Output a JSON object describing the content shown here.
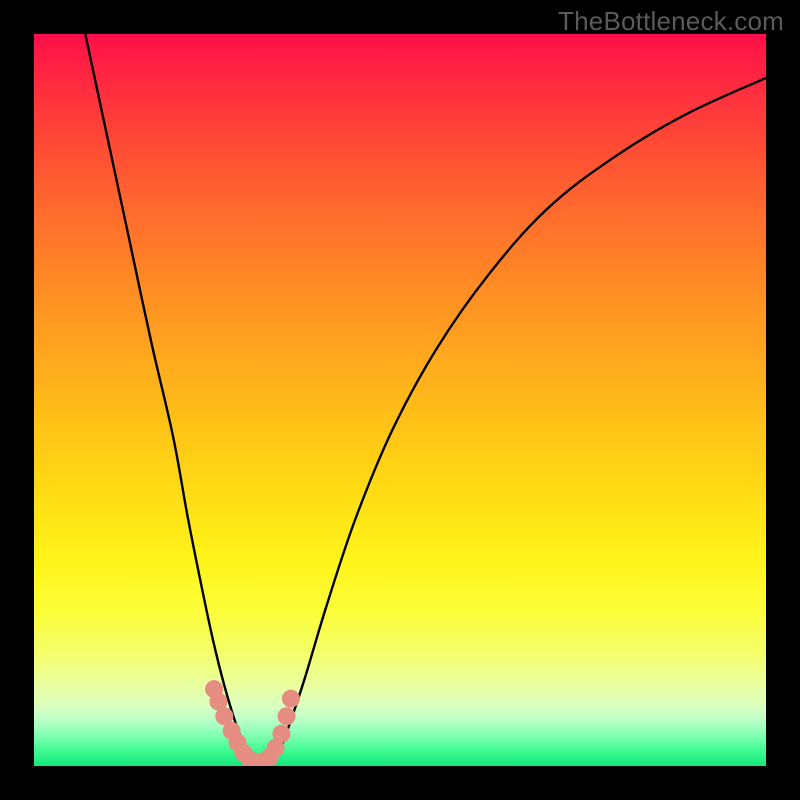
{
  "watermark": "TheBottleneck.com",
  "chart_data": {
    "type": "line",
    "title": "",
    "xlabel": "",
    "ylabel": "",
    "xlim": [
      0,
      100
    ],
    "ylim": [
      0,
      100
    ],
    "grid": false,
    "legend": false,
    "series": [
      {
        "name": "bottleneck-curve",
        "x": [
          7,
          10,
          13,
          16,
          19,
          21,
          23,
          24.5,
          26,
          27.5,
          29,
          30.5,
          32,
          33.5,
          35,
          37,
          40,
          44,
          49,
          55,
          62,
          70,
          79,
          89,
          100
        ],
        "values": [
          100,
          86,
          72,
          58,
          45,
          34,
          24,
          17,
          11,
          6,
          2,
          0,
          0,
          2,
          6,
          12,
          22,
          34,
          46,
          57,
          67,
          76,
          83,
          89,
          94
        ]
      }
    ],
    "notch": {
      "x_range": [
        24.5,
        35
      ],
      "dots_x": [
        24.6,
        25.2,
        26.0,
        27.0,
        27.8,
        28.6,
        29.5,
        30.4,
        31.3,
        32.2,
        33.0,
        33.8,
        34.5,
        35.1
      ],
      "dots_values": [
        10.5,
        8.8,
        6.8,
        4.8,
        3.2,
        1.8,
        0.9,
        0.5,
        0.6,
        1.2,
        2.5,
        4.4,
        6.8,
        9.2
      ]
    },
    "gradient_stops": [
      {
        "pct": 0,
        "color": "#ff0d4a"
      },
      {
        "pct": 24,
        "color": "#ff6a2e"
      },
      {
        "pct": 54,
        "color": "#ffc416"
      },
      {
        "pct": 79,
        "color": "#fcfe3a"
      },
      {
        "pct": 100,
        "color": "#12e779"
      }
    ]
  }
}
